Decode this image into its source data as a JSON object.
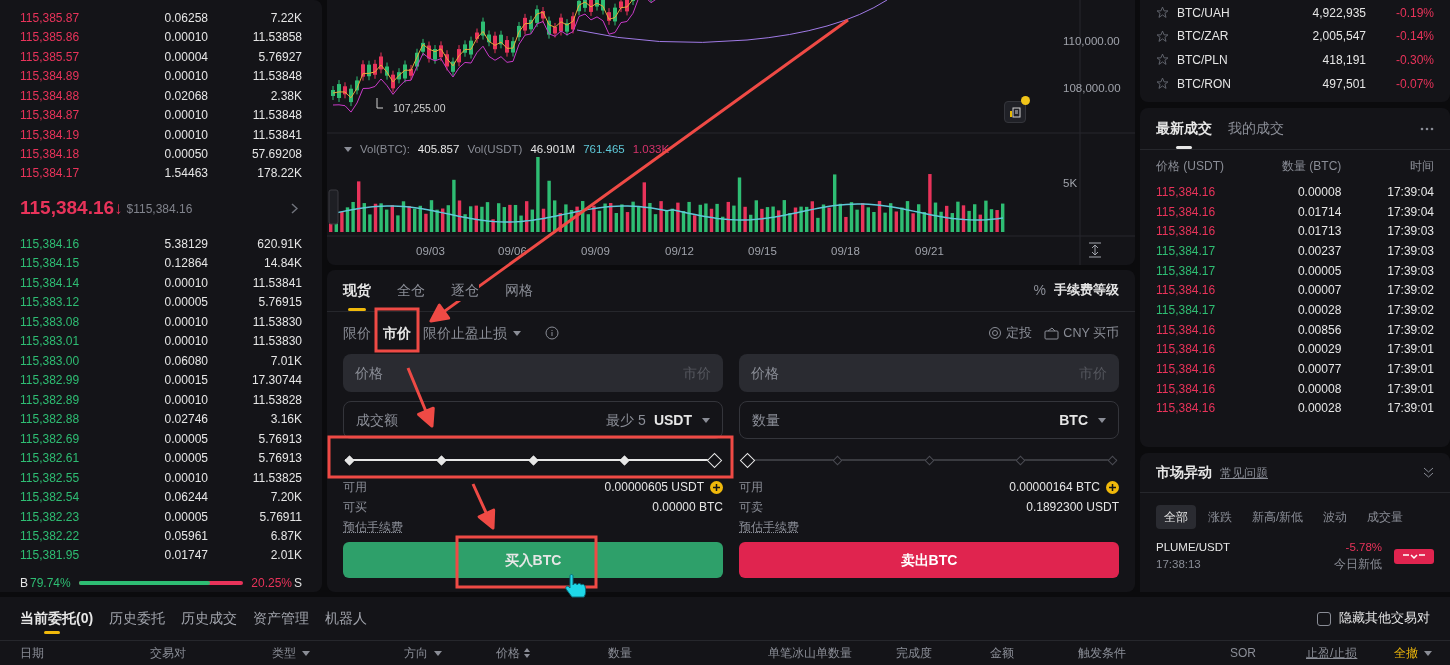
{
  "order_book": {
    "asks": [
      {
        "price": "115,385.87",
        "amount": "0.06258",
        "total": "7.22K"
      },
      {
        "price": "115,385.86",
        "amount": "0.00010",
        "total": "11.53858"
      },
      {
        "price": "115,385.57",
        "amount": "0.00004",
        "total": "5.76927"
      },
      {
        "price": "115,384.89",
        "amount": "0.00010",
        "total": "11.53848"
      },
      {
        "price": "115,384.88",
        "amount": "0.02068",
        "total": "2.38K"
      },
      {
        "price": "115,384.87",
        "amount": "0.00010",
        "total": "11.53848"
      },
      {
        "price": "115,384.19",
        "amount": "0.00010",
        "total": "11.53841"
      },
      {
        "price": "115,384.18",
        "amount": "0.00050",
        "total": "57.69208"
      },
      {
        "price": "115,384.17",
        "amount": "1.54463",
        "total": "178.22K"
      }
    ],
    "last_price": "115,384.16",
    "arrow": "↓",
    "usd_price": "$115,384.16",
    "bids": [
      {
        "price": "115,384.16",
        "amount": "5.38129",
        "total": "620.91K"
      },
      {
        "price": "115,384.15",
        "amount": "0.12864",
        "total": "14.84K"
      },
      {
        "price": "115,384.14",
        "amount": "0.00010",
        "total": "11.53841"
      },
      {
        "price": "115,383.12",
        "amount": "0.00005",
        "total": "5.76915"
      },
      {
        "price": "115,383.08",
        "amount": "0.00010",
        "total": "11.53830"
      },
      {
        "price": "115,383.01",
        "amount": "0.00010",
        "total": "11.53830"
      },
      {
        "price": "115,383.00",
        "amount": "0.06080",
        "total": "7.01K"
      },
      {
        "price": "115,382.99",
        "amount": "0.00015",
        "total": "17.30744"
      },
      {
        "price": "115,382.89",
        "amount": "0.00010",
        "total": "11.53828"
      },
      {
        "price": "115,382.88",
        "amount": "0.02746",
        "total": "3.16K"
      },
      {
        "price": "115,382.69",
        "amount": "0.00005",
        "total": "5.76913"
      },
      {
        "price": "115,382.61",
        "amount": "0.00005",
        "total": "5.76913"
      },
      {
        "price": "115,382.55",
        "amount": "0.00010",
        "total": "11.53825"
      },
      {
        "price": "115,382.54",
        "amount": "0.06244",
        "total": "7.20K"
      },
      {
        "price": "115,382.23",
        "amount": "0.00005",
        "total": "5.76911"
      },
      {
        "price": "115,382.22",
        "amount": "0.05961",
        "total": "6.87K"
      },
      {
        "price": "115,381.95",
        "amount": "0.01747",
        "total": "2.01K"
      }
    ],
    "ratio": {
      "buy_label": "B",
      "buy_value": "79.74%",
      "level": 0.7974,
      "sell_value": "20.25%",
      "sell_label": "S"
    }
  },
  "chart": {
    "price_ticks": [
      "110,000.00",
      "108,000.00"
    ],
    "low_marker": "107,255.00",
    "volume_legend": [
      {
        "text": "Vol(BTC):",
        "color": "#8a8d96"
      },
      {
        "text": "405.857",
        "color": "#e6e6e6"
      },
      {
        "text": "Vol(USDT)",
        "color": "#8a8d96"
      },
      {
        "text": "46.901M",
        "color": "#e6e6e6"
      },
      {
        "text": "761.465",
        "color": "#5ec8d8"
      },
      {
        "text": "1.033K",
        "color": "#d6336c"
      }
    ],
    "volume_tick": "5K",
    "dates": [
      "09/03",
      "09/06",
      "09/09",
      "09/12",
      "09/15",
      "09/18",
      "09/21"
    ]
  },
  "order_form": {
    "tabs": [
      {
        "label": "现货",
        "selected": true
      },
      {
        "label": "全仓",
        "selected": false
      },
      {
        "label": "逐仓",
        "selected": false
      },
      {
        "label": "网格",
        "selected": false
      }
    ],
    "fee_icon": "%",
    "fee_label": "手续费等级",
    "order_types": [
      {
        "label": "限价",
        "selected": false,
        "kind": "plain"
      },
      {
        "label": "市价",
        "selected": true,
        "kind": "plain"
      },
      {
        "label": "限价止盈止损",
        "selected": false,
        "kind": "dropdown"
      }
    ],
    "links": [
      "定投",
      "CNY 买币"
    ],
    "sides": [
      {
        "kind": "buy",
        "price_label": "价格",
        "price_placeholder": "市价",
        "amount_label": "成交额",
        "amount_hint": "最少 5",
        "unit": "USDT",
        "level": 1,
        "rows": [
          {
            "kind": "balance",
            "label": "可用",
            "value": "0.00000605 USDT"
          },
          {
            "kind": "plain",
            "label": "可买",
            "value": "0.00000 BTC"
          },
          {
            "kind": "estimate",
            "label": "预估手续费"
          }
        ],
        "button": "买入BTC"
      },
      {
        "kind": "sell",
        "price_label": "价格",
        "price_placeholder": "市价",
        "amount_label": "数量",
        "unit": "BTC",
        "level": 0,
        "rows": [
          {
            "kind": "balance",
            "label": "可用",
            "value": "0.00000164 BTC"
          },
          {
            "kind": "plain",
            "label": "可卖",
            "value": "0.1892300 USDT"
          },
          {
            "kind": "estimate",
            "label": "预估手续费"
          }
        ],
        "button": "卖出BTC"
      }
    ]
  },
  "markets": [
    {
      "pair": "BTC/UAH",
      "price": "4,922,935",
      "change": "-0.19%"
    },
    {
      "pair": "BTC/ZAR",
      "price": "2,005,547",
      "change": "-0.14%"
    },
    {
      "pair": "BTC/PLN",
      "price": "418,191",
      "change": "-0.30%"
    },
    {
      "pair": "BTC/RON",
      "price": "497,501",
      "change": "-0.07%"
    }
  ],
  "trades": {
    "tabs": [
      {
        "label": "最新成交",
        "selected": true
      },
      {
        "label": "我的成交",
        "selected": false
      }
    ],
    "columns": [
      "价格 (USDT)",
      "数量 (BTC)",
      "时间"
    ],
    "rows": [
      {
        "color": "#e8335a",
        "price": "115,384.16",
        "amount": "0.00008",
        "time": "17:39:04"
      },
      {
        "color": "#e8335a",
        "price": "115,384.16",
        "amount": "0.01714",
        "time": "17:39:04"
      },
      {
        "color": "#e8335a",
        "price": "115,384.16",
        "amount": "0.01713",
        "time": "17:39:03"
      },
      {
        "color": "#2ebd73",
        "price": "115,384.17",
        "amount": "0.00237",
        "time": "17:39:03"
      },
      {
        "color": "#2ebd73",
        "price": "115,384.17",
        "amount": "0.00005",
        "time": "17:39:03"
      },
      {
        "color": "#e8335a",
        "price": "115,384.16",
        "amount": "0.00007",
        "time": "17:39:02"
      },
      {
        "color": "#2ebd73",
        "price": "115,384.17",
        "amount": "0.00028",
        "time": "17:39:02"
      },
      {
        "color": "#e8335a",
        "price": "115,384.16",
        "amount": "0.00856",
        "time": "17:39:02"
      },
      {
        "color": "#e8335a",
        "price": "115,384.16",
        "amount": "0.00029",
        "time": "17:39:01"
      },
      {
        "color": "#e8335a",
        "price": "115,384.16",
        "amount": "0.00077",
        "time": "17:39:01"
      },
      {
        "color": "#e8335a",
        "price": "115,384.16",
        "amount": "0.00008",
        "time": "17:39:01"
      },
      {
        "color": "#e8335a",
        "price": "115,384.16",
        "amount": "0.00028",
        "time": "17:39:01"
      }
    ]
  },
  "movers": {
    "title": "市场异动",
    "link": "常见问题",
    "filters": [
      {
        "label": "全部",
        "selected": true
      },
      {
        "label": "涨跌",
        "selected": false
      },
      {
        "label": "新高/新低",
        "selected": false
      },
      {
        "label": "波动",
        "selected": false
      },
      {
        "label": "成交量",
        "selected": false
      }
    ],
    "items": [
      {
        "pair": "PLUME/USDT",
        "time": "17:38:13",
        "change": "-5.78%",
        "note": "今日新低"
      }
    ]
  },
  "orders": {
    "tabs": [
      {
        "label": "当前委托(0)",
        "selected": true
      },
      {
        "label": "历史委托",
        "selected": false
      },
      {
        "label": "历史成交",
        "selected": false
      },
      {
        "label": "资产管理",
        "selected": false
      },
      {
        "label": "机器人",
        "selected": false
      }
    ],
    "hide_others": {
      "label": "隐藏其他交易对",
      "checked": false
    },
    "columns": [
      {
        "label": "日期",
        "kind": "plain"
      },
      {
        "label": "交易对",
        "kind": "plain"
      },
      {
        "label": "类型",
        "kind": "dropdown"
      },
      {
        "label": "方向",
        "kind": "dropdown"
      },
      {
        "label": "价格",
        "kind": "sort"
      },
      {
        "label": "数量",
        "kind": "plain"
      },
      {
        "label": "单笔冰山单数量",
        "kind": "plain"
      },
      {
        "label": "完成度",
        "kind": "plain"
      },
      {
        "label": "金额",
        "kind": "plain"
      },
      {
        "label": "触发条件",
        "kind": "plain"
      },
      {
        "label": "SOR",
        "kind": "plain"
      },
      {
        "label": "止盈/止损",
        "kind": "link"
      },
      {
        "label": "全撤",
        "kind": "action"
      }
    ]
  }
}
